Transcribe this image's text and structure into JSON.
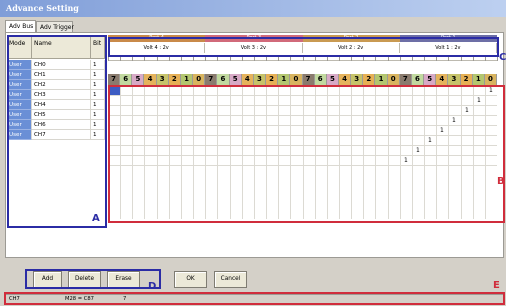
{
  "window": {
    "title": "Advance Setting"
  },
  "tabs": [
    {
      "label": "Adv Bus",
      "active": true
    },
    {
      "label": "Adv Trigger",
      "active": false
    }
  ],
  "list": {
    "headers": [
      "Mode",
      "Name",
      "Bit"
    ],
    "rows": [
      {
        "mode": "User",
        "name": "CH0",
        "bit": "1"
      },
      {
        "mode": "User",
        "name": "CH1",
        "bit": "1"
      },
      {
        "mode": "User",
        "name": "CH2",
        "bit": "1"
      },
      {
        "mode": "User",
        "name": "CH3",
        "bit": "1"
      },
      {
        "mode": "User",
        "name": "CH4",
        "bit": "1"
      },
      {
        "mode": "User",
        "name": "CH5",
        "bit": "1"
      },
      {
        "mode": "User",
        "name": "CH6",
        "bit": "1"
      },
      {
        "mode": "User",
        "name": "CH7",
        "bit": "1"
      }
    ]
  },
  "ports": [
    {
      "label": "Port 4",
      "color": "#c98a4a",
      "volt": "Volt 4 : 2v"
    },
    {
      "label": "Port 3",
      "color": "#d16a7a",
      "volt": "Volt 3 : 2v"
    },
    {
      "label": "Port 2",
      "color": "#c99a52",
      "volt": "Volt 2 : 2v"
    },
    {
      "label": "Port 1",
      "color": "#6d6fa6",
      "volt": "Volt 1 : 2v"
    }
  ],
  "bits": [
    "7",
    "6",
    "5",
    "4",
    "3",
    "2",
    "1",
    "0"
  ],
  "bit_colors": [
    "#8a7b6e",
    "#c1d99f",
    "#d7a9c6",
    "#e5b35c",
    "#c6c36a",
    "#e6b055",
    "#b3c66f",
    "#d8b45f"
  ],
  "grid": {
    "selected_row": 0,
    "marks": [
      {
        "row": 0,
        "col": 31,
        "text": "1"
      },
      {
        "row": 1,
        "col": 30,
        "text": "1"
      },
      {
        "row": 2,
        "col": 29,
        "text": "1"
      },
      {
        "row": 3,
        "col": 28,
        "text": "1"
      },
      {
        "row": 4,
        "col": 27,
        "text": "1"
      },
      {
        "row": 5,
        "col": 26,
        "text": "1"
      },
      {
        "row": 6,
        "col": 25,
        "text": "1"
      },
      {
        "row": 7,
        "col": 24,
        "text": "1"
      }
    ]
  },
  "buttons": {
    "add": "Add",
    "delete": "Delete",
    "erase": "Erase",
    "ok": "OK",
    "cancel": "Cancel"
  },
  "status": {
    "left": "CH7",
    "mid": "M28 = C87",
    "right": "7"
  },
  "markers": {
    "a": "A",
    "b": "B",
    "c": "C",
    "d": "D",
    "e": "E"
  }
}
